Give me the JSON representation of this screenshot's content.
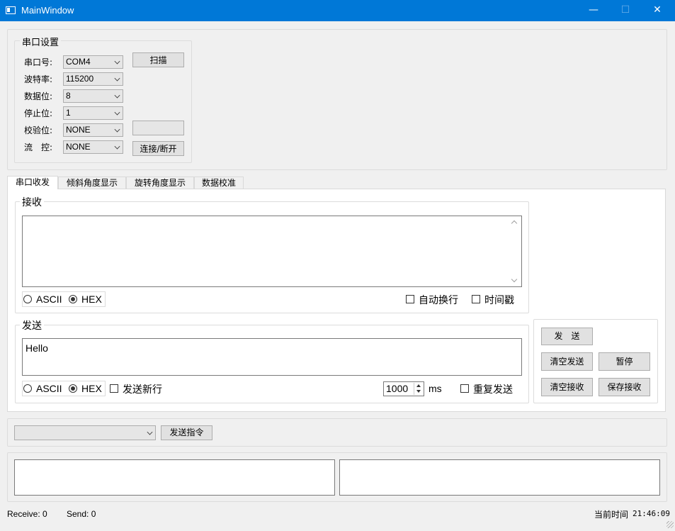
{
  "window": {
    "title": "MainWindow",
    "minimize_glyph": "—",
    "maximize_glyph": "☐",
    "close_glyph": "✕"
  },
  "serial_settings": {
    "group_title": "串口设置",
    "rows": [
      {
        "label": "串口号:",
        "value": "COM4"
      },
      {
        "label": "波特率:",
        "value": "115200"
      },
      {
        "label": "数据位:",
        "value": "8"
      },
      {
        "label": "停止位:",
        "value": "1"
      },
      {
        "label": "校验位:",
        "value": "NONE"
      },
      {
        "label": "流　控:",
        "value": "NONE"
      }
    ],
    "scan_button": "扫描",
    "blank_button": "",
    "connect_button": "连接/断开"
  },
  "tabs": [
    "串口收发",
    "倾斜角度显示",
    "旋转角度显示",
    "数据校准"
  ],
  "receive": {
    "group_title": "接收",
    "text": "",
    "ascii_label": "ASCII",
    "hex_label": "HEX",
    "auto_wrap_label": "自动换行",
    "timestamp_label": "时间戳"
  },
  "send": {
    "group_title": "发送",
    "text": "Hello",
    "ascii_label": "ASCII",
    "hex_label": "HEX",
    "newline_label": "发送新行",
    "interval_value": "1000",
    "interval_unit": "ms",
    "repeat_label": "重复发送"
  },
  "actions": {
    "send_button": "发　送",
    "clear_send_button": "清空发送",
    "pause_button": "暂停",
    "clear_receive_button": "清空接收",
    "save_receive_button": "保存接收"
  },
  "command": {
    "selected": "",
    "send_command_button": "发送指令"
  },
  "statusbar": {
    "receive": "Receive: 0",
    "send": "Send: 0",
    "time_label": "当前时间",
    "time_value": "21:46:09"
  }
}
